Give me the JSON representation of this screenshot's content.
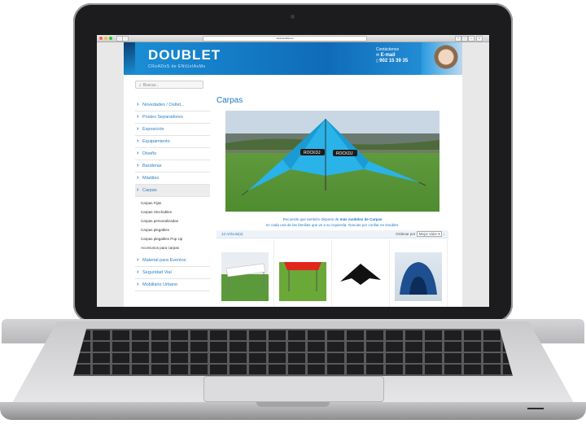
{
  "browser": {
    "url": "www.doublet.es"
  },
  "header": {
    "logo": "DOUBLET",
    "tagline": "CReADoS de ENtUsIAsMo",
    "contact_title": "Contáctenos",
    "contact_email": "E-mail",
    "contact_phone": "902 15 39 35"
  },
  "search": {
    "placeholder": "Buscar..."
  },
  "menu": {
    "items": [
      "Novedades / Outlet...",
      "Postes Separadores",
      "Exposición",
      "Equipamiento",
      "Diseño",
      "Banderas",
      "Mástiles",
      "Carpas"
    ],
    "subitems": [
      "Carpas Fijas",
      "Carpas Hinchables",
      "Carpas personalizadas",
      "Carpas plegables",
      "Carpas plegables Pop Up",
      "Accesorios para carpas"
    ],
    "items_after": [
      "Material para Eventos",
      "Seguridad Vial",
      "Mobiliario Urbano"
    ]
  },
  "main": {
    "title": "Carpas",
    "note_line1_pre": "Recuerde que también dispone de ",
    "note_line1_bold": "más modelos de Carpas",
    "note_line2": "en cada una de las familias que ve a su izquierda. Gracias por confiar en Doublet.",
    "count": "12 Artículo(s)",
    "sort_label": "Ordenar por",
    "sort_value": "Mejor valor",
    "tent_brand": "ROCKDJ"
  },
  "colors": {
    "accent": "#1b7ac8",
    "header": "#0f6bb8"
  }
}
